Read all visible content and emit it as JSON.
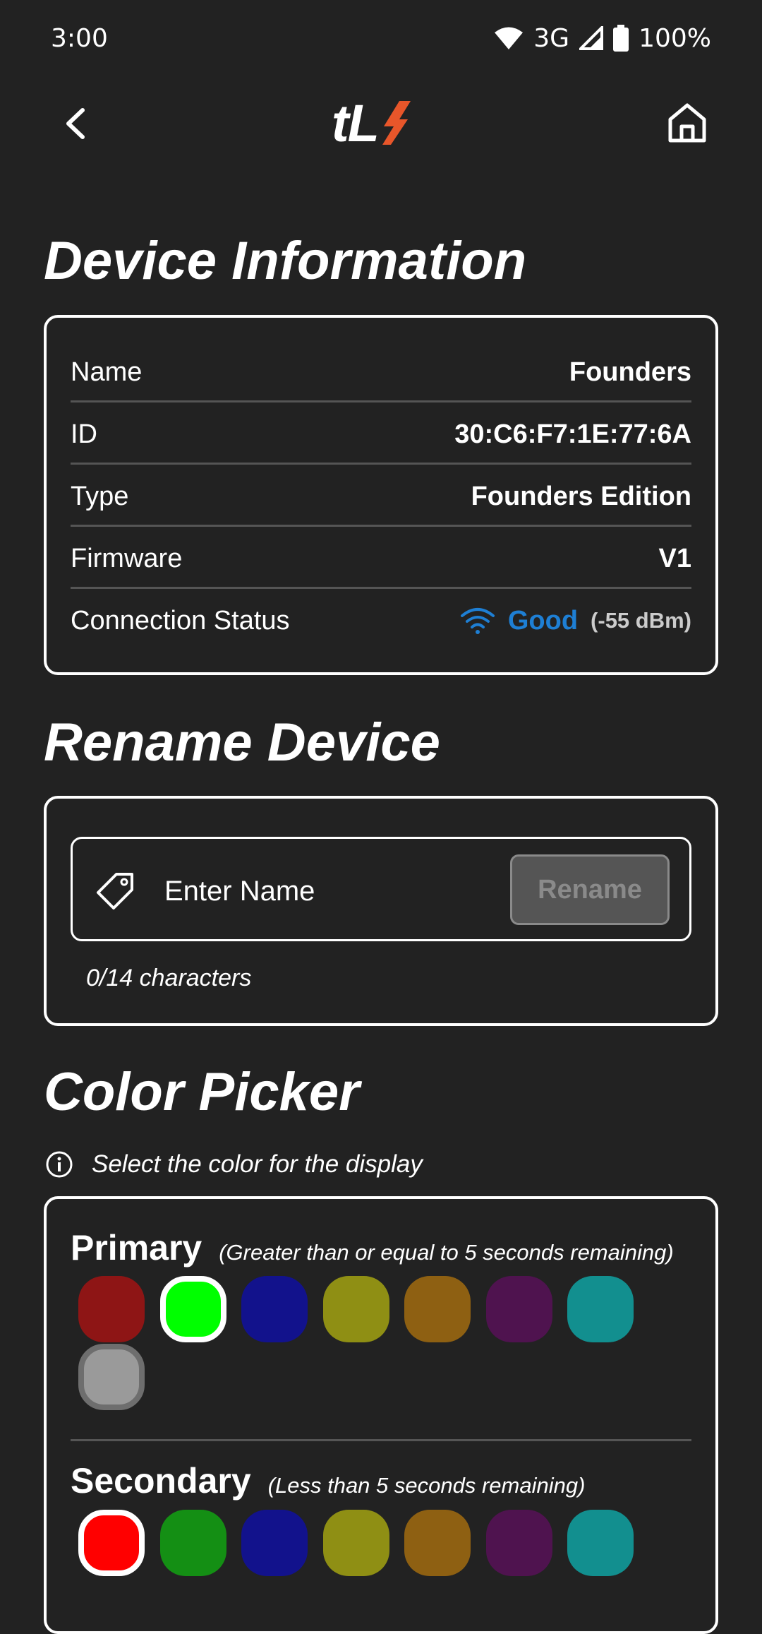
{
  "status_bar": {
    "time": "3:00",
    "network": "3G",
    "battery": "100%"
  },
  "nav": {
    "logo_text": "tL",
    "logo_accent_color": "#e8562a"
  },
  "device_info": {
    "title": "Device Information",
    "rows": [
      {
        "label": "Name",
        "value": "Founders"
      },
      {
        "label": "ID",
        "value": "30:C6:F7:1E:77:6A"
      },
      {
        "label": "Type",
        "value": "Founders Edition"
      },
      {
        "label": "Firmware",
        "value": "V1"
      }
    ],
    "connection": {
      "label": "Connection Status",
      "quality": "Good",
      "signal": "(-55 dBm)",
      "color": "#1e7fd4"
    }
  },
  "rename": {
    "title": "Rename Device",
    "placeholder": "Enter Name",
    "value": "",
    "button_label": "Rename",
    "char_count": "0/14 characters"
  },
  "color_picker": {
    "title": "Color Picker",
    "hint": "Select the color for the display",
    "primary": {
      "label": "Primary",
      "note": "(Greater than or equal to 5 seconds remaining)",
      "swatches": [
        {
          "name": "red",
          "color": "#8e1515",
          "selected": false
        },
        {
          "name": "green",
          "color": "#00ff00",
          "selected": true
        },
        {
          "name": "blue",
          "color": "#12128c",
          "selected": false
        },
        {
          "name": "yellow",
          "color": "#8f8f14",
          "selected": false
        },
        {
          "name": "orange",
          "color": "#8e6012",
          "selected": false
        },
        {
          "name": "purple",
          "color": "#4f134f",
          "selected": false
        },
        {
          "name": "teal",
          "color": "#128f8f",
          "selected": false
        },
        {
          "name": "gray",
          "color": "#9a9a9a",
          "selected": false
        }
      ]
    },
    "secondary": {
      "label": "Secondary",
      "note": "(Less than 5 seconds remaining)",
      "swatches": [
        {
          "name": "red",
          "color": "#ff0000",
          "selected": true
        },
        {
          "name": "green",
          "color": "#148f14",
          "selected": false
        },
        {
          "name": "blue",
          "color": "#12128c",
          "selected": false
        },
        {
          "name": "yellow",
          "color": "#8f8f14",
          "selected": false
        },
        {
          "name": "orange",
          "color": "#8e6012",
          "selected": false
        },
        {
          "name": "purple",
          "color": "#4f134f",
          "selected": false
        },
        {
          "name": "teal",
          "color": "#128f8f",
          "selected": false
        }
      ]
    }
  }
}
